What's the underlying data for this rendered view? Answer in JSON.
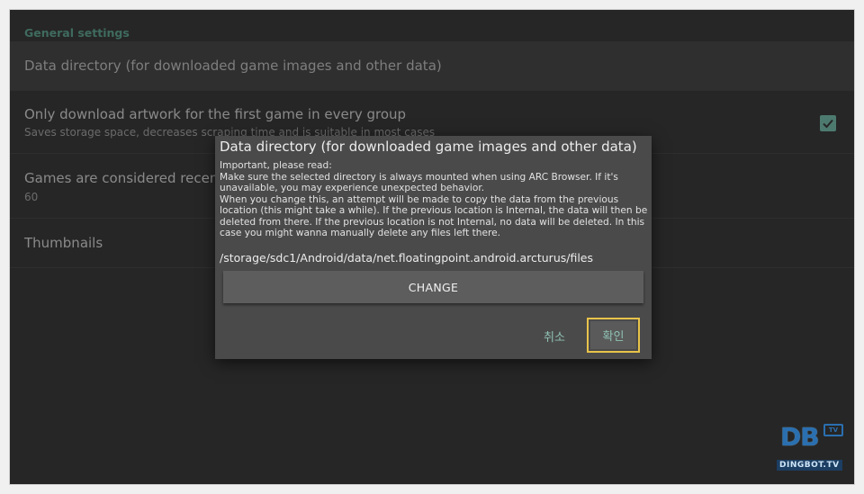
{
  "settings": {
    "section_header": "General settings",
    "rows": [
      {
        "title": "Data directory (for downloaded game images and other data)"
      },
      {
        "title": "Only download artwork for the first game in every group",
        "summary": "Saves storage space, decreases scraping time and is suitable in most cases",
        "checked": true
      },
      {
        "title": "Games are considered recently",
        "summary": "60"
      },
      {
        "title": "Thumbnails"
      }
    ]
  },
  "dialog": {
    "title": "Data directory (for downloaded game images and other data)",
    "message": [
      "Important, please read:",
      "Make sure the selected directory is always mounted when using ARC Browser. If it's unavailable, you may experience unexpected behavior.",
      "When you change this, an attempt will be made to copy the data from the previous location (this might take a while). If the previous location is Internal, the data will then be deleted from there. If the previous location is not Internal, no data will be deleted. In this case you might wanna manually delete any files left there."
    ],
    "path": "/storage/sdc1/Android/data/net.floatingpoint.android.arcturus/files",
    "change_label": "CHANGE",
    "cancel_label": "취소",
    "ok_label": "확인"
  },
  "watermark": {
    "logo": "DB",
    "tv": "TV",
    "text": "DINGBOT.TV"
  },
  "colors": {
    "accent": "#8fc1b3",
    "checkbox": "#4d7a6f",
    "focus_border": "#e8c34a",
    "dialog_bg": "#4a4a4a",
    "screen_bg": "#262626"
  }
}
